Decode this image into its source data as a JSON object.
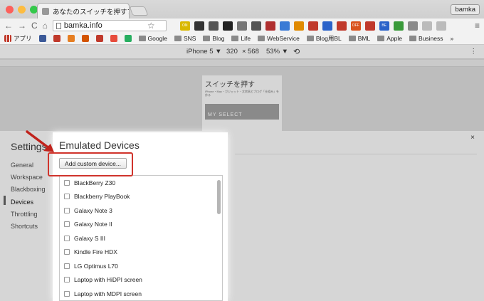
{
  "window": {
    "tab_title": "あなたのスイッチを押すブログ",
    "tab_close": "×",
    "profile_name": "bamka"
  },
  "toolbar": {
    "back": "←",
    "forward": "→",
    "reload": "C",
    "home": "⌂",
    "url": "bamka.info",
    "star": "☆",
    "menu": "≡",
    "extensions": [
      {
        "name": "on-ext",
        "color": "#d9b800",
        "label": "ON"
      },
      {
        "name": "ext-2",
        "color": "#333333"
      },
      {
        "name": "ext-3",
        "color": "#555555"
      },
      {
        "name": "buffer-ext",
        "color": "#222222"
      },
      {
        "name": "ext-5",
        "color": "#777777"
      },
      {
        "name": "ext-6",
        "color": "#555555"
      },
      {
        "name": "ext-7",
        "color": "#b03030"
      },
      {
        "name": "ext-8",
        "color": "#3a7bd5"
      },
      {
        "name": "ext-9",
        "color": "#e08a00"
      },
      {
        "name": "ext-10",
        "color": "#c0392b"
      },
      {
        "name": "ext-11",
        "color": "#2a62c9"
      },
      {
        "name": "ext-12",
        "color": "#c0392b"
      },
      {
        "name": "off-ext",
        "color": "#d9531e",
        "label": "OFF"
      },
      {
        "name": "ext-14",
        "color": "#c0392b"
      },
      {
        "name": "be-ext",
        "color": "#2a62c9",
        "label": "BE"
      },
      {
        "name": "ext-16",
        "color": "#3a9a3a"
      },
      {
        "name": "ext-17",
        "color": "#8a8a8a"
      },
      {
        "name": "ext-18",
        "color": "#bbbbbb"
      },
      {
        "name": "ext-19",
        "color": "#bbbbbb"
      }
    ]
  },
  "bookmarks": {
    "apps_label": "アプリ",
    "items": [
      {
        "label": "Google",
        "type": "folder"
      },
      {
        "label": "SNS",
        "type": "folder"
      },
      {
        "label": "Blog",
        "type": "folder"
      },
      {
        "label": "Life",
        "type": "folder"
      },
      {
        "label": "WebService",
        "type": "folder"
      },
      {
        "label": "Blog用BL",
        "type": "folder"
      },
      {
        "label": "BML",
        "type": "folder"
      },
      {
        "label": "Apple",
        "type": "folder"
      },
      {
        "label": "Business",
        "type": "folder"
      }
    ],
    "more": "»"
  },
  "device_toolbar": {
    "device": "iPhone 5 ▼",
    "width": "320",
    "times": "×",
    "height": "568",
    "zoom": "53% ▼",
    "rotate": "⟲",
    "more": "⋮"
  },
  "preview": {
    "logo": "スイッチを押す",
    "text": "iPhone・Mac・ガジェット・文房具とブログ「仕組み」を作る",
    "banner": "MY SELECT"
  },
  "settings": {
    "title": "Settings",
    "close": "×",
    "nav": [
      "General",
      "Workspace",
      "Blackboxing",
      "Devices",
      "Throttling",
      "Shortcuts"
    ],
    "selected_index": 3
  },
  "emulated_devices": {
    "title": "Emulated Devices",
    "add_button": "Add custom device...",
    "devices": [
      "BlackBerry Z30",
      "Blackberry PlayBook",
      "Galaxy Note 3",
      "Galaxy Note II",
      "Galaxy S III",
      "Kindle Fire HDX",
      "LG Optimus L70",
      "Laptop with HiDPI screen",
      "Laptop with MDPI screen"
    ]
  },
  "colors": {
    "highlight_border": "#d0342c",
    "arrow": "#c0231c"
  }
}
